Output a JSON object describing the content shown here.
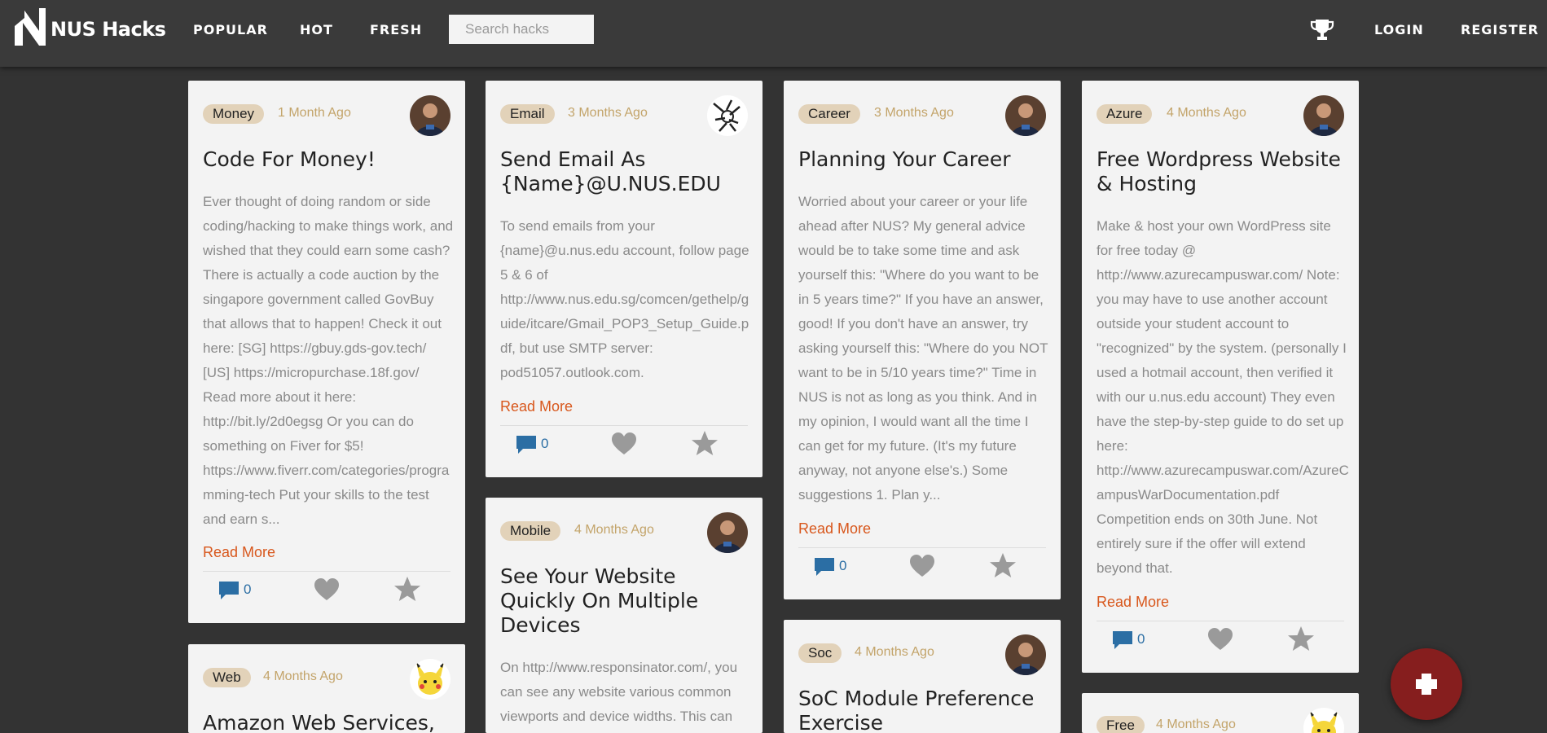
{
  "header": {
    "brand": "NUS Hacks",
    "nav": [
      "POPULAR",
      "HOT",
      "FRESH"
    ],
    "search_placeholder": "Search hacks",
    "login": "LOGIN",
    "register": "REGISTER"
  },
  "cards": [
    {
      "tag": "Money",
      "time": "1 Month Ago",
      "title": "Code For Money!",
      "excerpt": "Ever thought of doing random or side coding/hacking to make things work, and wished that they could earn some cash? There is actually a code auction by the singapore government called GovBuy that allows that to happen! Check it out here: [SG] https://gbuy.gds-gov.tech/ [US] https://micropurchase.18f.gov/ Read more about it here: http://bit.ly/2d0egsg Or you can do something on Fiver for $5! https://www.fiverr.com/categories/programming-tech Put your skills to the test and earn s...",
      "read_more": "Read More",
      "comments": "0"
    },
    {
      "tag": "Email",
      "time": "3 Months Ago",
      "title": "Send Email As {Name}@U.NUS.EDU",
      "excerpt": "To send emails from your {name}@u.nus.edu account, follow page 5 & 6 of http://www.nus.edu.sg/comcen/gethelp/guide/itcare/Gmail_POP3_Setup_Guide.pdf, but use SMTP server: pod51057.outlook.com.",
      "read_more": "Read More",
      "comments": "0"
    },
    {
      "tag": "Career",
      "time": "3 Months Ago",
      "title": "Planning Your Career",
      "excerpt": "Worried about your career or your life ahead after NUS? My general advice would be to take some time and ask yourself this: \"Where do you want to be in 5 years time?\" If you have an answer, good! If you don't have an answer, try asking yourself this: \"Where do you NOT want to be in 5/10 years time?\" Time in NUS is not as long as you think. And in my opinion, I would want all the time I can get for my future. (It's my future anyway, not anyone else's.) Some suggestions 1. Plan y...",
      "read_more": "Read More",
      "comments": "0"
    },
    {
      "tag": "Azure",
      "time": "4 Months Ago",
      "title": "Free Wordpress Website & Hosting",
      "excerpt": "Make & host your own WordPress site for free today @ http://www.azurecampuswar.com/ Note: you may have to use another account outside your student account to \"recognized\" by the system. (personally I used a hotmail account, then verified it with our u.nus.edu account) They even have the step-by-step guide to do set up here: http://www.azurecampuswar.com/AzureCampusWarDocumentation.pdf Competition ends on 30th June. Not entirely sure if the offer will extend beyond that.",
      "read_more": "Read More",
      "comments": "0"
    },
    {
      "tag": "Web",
      "time": "4 Months Ago",
      "title": "Amazon Web Services,"
    },
    {
      "tag": "Mobile",
      "time": "4 Months Ago",
      "title": "See Your Website Quickly On Multiple Devices",
      "excerpt": "On http://www.responsinator.com/, you can see any website various common viewports and device widths. This can"
    },
    {
      "tag": "Soc",
      "time": "4 Months Ago",
      "title": "SoC Module Preference Exercise"
    },
    {
      "tag": "Free",
      "time": "4 Months Ago"
    }
  ],
  "icons": {
    "logo": "nus-hacks-logo",
    "trophy": "trophy-icon",
    "comment": "comment-icon",
    "heart": "heart-icon",
    "star": "star-icon",
    "add": "plus-icon"
  },
  "colors": {
    "background": "#333333",
    "navbar": "#3a3a3a",
    "card": "#f3f3f3",
    "tag": "#e2d2b9",
    "time": "#c3a46a",
    "read_more": "#d8571c",
    "comment": "#2b6ea4",
    "fab": "#861e1e"
  }
}
